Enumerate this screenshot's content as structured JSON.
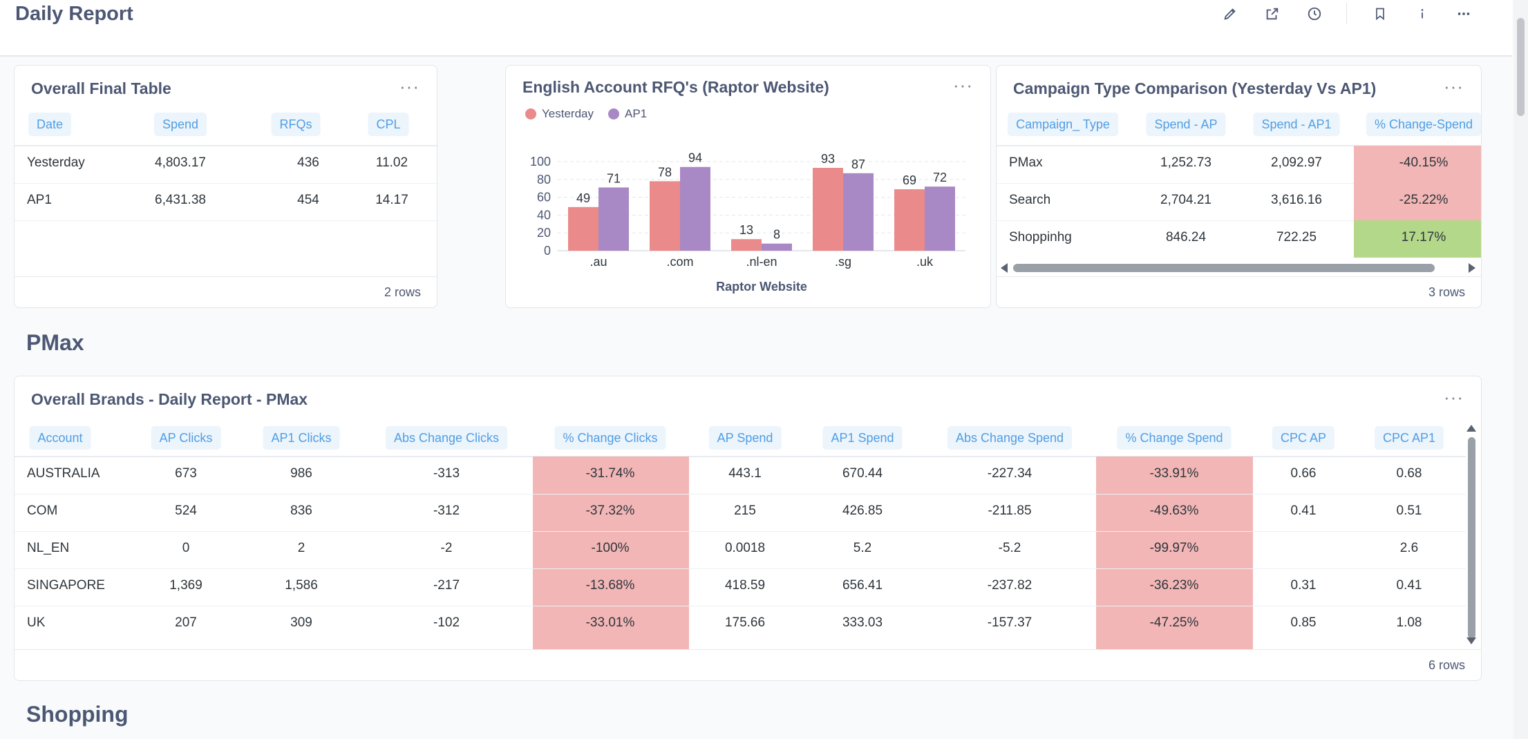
{
  "header": {
    "title": "Daily Report"
  },
  "icons": [
    "pencil-icon",
    "share-icon",
    "clock-icon",
    "bookmark-icon",
    "info-icon",
    "more-icon"
  ],
  "colors": {
    "yesterday": "#ea8a8a",
    "ap1": "#a989c5",
    "negative": "#f2b6b6",
    "positive": "#b4d88a",
    "accent": "#509ee3"
  },
  "overall_table": {
    "title": "Overall Final Table",
    "columns": [
      "Date",
      "Spend",
      "RFQs",
      "CPL"
    ],
    "rows": [
      [
        "Yesterday",
        "4,803.17",
        "436",
        "11.02"
      ],
      [
        "AP1",
        "6,431.38",
        "454",
        "14.17"
      ]
    ],
    "footer": "2 rows"
  },
  "rfq_chart": {
    "title": "English Account RFQ's (Raptor Website)",
    "legend": [
      "Yesterday",
      "AP1"
    ],
    "xlabel": "Raptor Website",
    "chart_data": {
      "type": "bar",
      "categories": [
        ".au",
        ".com",
        ".nl-en",
        ".sg",
        ".uk"
      ],
      "series": [
        {
          "name": "Yesterday",
          "values": [
            49,
            78,
            13,
            93,
            69
          ]
        },
        {
          "name": "AP1",
          "values": [
            71,
            94,
            8,
            87,
            72
          ]
        }
      ],
      "yticks": [
        0,
        20,
        40,
        60,
        80,
        100
      ],
      "ylim": [
        0,
        100
      ],
      "xlabel": "Raptor Website",
      "legend_position": "top-left",
      "grid": true
    }
  },
  "campaign_table": {
    "title": "Campaign Type Comparison (Yesterday Vs AP1)",
    "columns": [
      "Campaign_ Type",
      "Spend - AP",
      "Spend - AP1",
      "% Change-Spend"
    ],
    "rows": [
      [
        "PMax",
        "1,252.73",
        "2,092.97",
        "-40.15%"
      ],
      [
        "Search",
        "2,704.21",
        "3,616.16",
        "-25.22%"
      ],
      [
        "Shoppinhg",
        "846.24",
        "722.25",
        "17.17%"
      ]
    ],
    "footer": "3 rows"
  },
  "pmax_section": {
    "title": "PMax"
  },
  "brands_table": {
    "title": "Overall Brands - Daily Report - PMax",
    "columns": [
      "Account",
      "AP Clicks",
      "AP1 Clicks",
      "Abs Change Clicks",
      "% Change Clicks",
      "AP Spend",
      "AP1 Spend",
      "Abs Change Spend",
      "% Change Spend",
      "CPC AP",
      "CPC AP1"
    ],
    "rows": [
      [
        "AUSTRALIA",
        "673",
        "986",
        "-313",
        "-31.74%",
        "443.1",
        "670.44",
        "-227.34",
        "-33.91%",
        "0.66",
        "0.68"
      ],
      [
        "COM",
        "524",
        "836",
        "-312",
        "-37.32%",
        "215",
        "426.85",
        "-211.85",
        "-49.63%",
        "0.41",
        "0.51"
      ],
      [
        "NL_EN",
        "0",
        "2",
        "-2",
        "-100%",
        "0.0018",
        "5.2",
        "-5.2",
        "-99.97%",
        "",
        "2.6"
      ],
      [
        "SINGAPORE",
        "1,369",
        "1,586",
        "-217",
        "-13.68%",
        "418.59",
        "656.41",
        "-237.82",
        "-36.23%",
        "0.31",
        "0.41"
      ],
      [
        "UK",
        "207",
        "309",
        "-102",
        "-33.01%",
        "175.66",
        "333.03",
        "-157.37",
        "-47.25%",
        "0.85",
        "1.08"
      ]
    ],
    "footer": "6 rows"
  },
  "shopping_section": {
    "title": "Shopping"
  }
}
